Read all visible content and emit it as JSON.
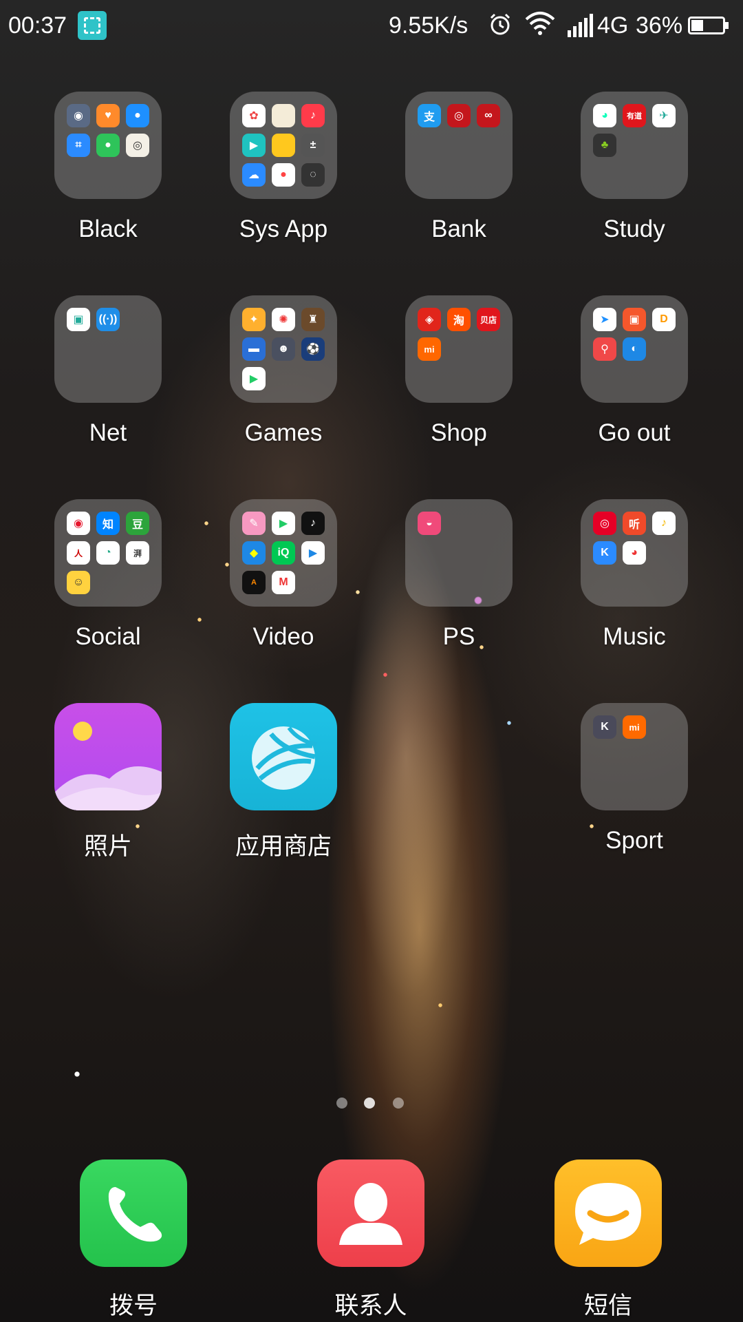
{
  "status_bar": {
    "time": "00:37",
    "net_speed": "9.55K/s",
    "network": "4G",
    "battery": "36%",
    "icons": [
      "screenshot-icon",
      "alarm-icon",
      "wifi-icon",
      "signal-icon",
      "battery-icon"
    ]
  },
  "folders": [
    {
      "name": "Black",
      "apps": [
        "settings",
        "health",
        "maps",
        "scan",
        "recorder",
        "camera"
      ]
    },
    {
      "name": "Sys App",
      "apps": [
        "gallery",
        "notes",
        "music",
        "video",
        "files",
        "calculator",
        "cloud",
        "recorder",
        "compass"
      ]
    },
    {
      "name": "Bank",
      "apps": [
        "alipay",
        "bank-1",
        "bank-2"
      ]
    },
    {
      "name": "Study",
      "apps": [
        "dictionary",
        "youdao",
        "study-app",
        "study-app-2"
      ]
    },
    {
      "name": "Net",
      "apps": [
        "net-app",
        "hotspot-app"
      ]
    },
    {
      "name": "Games",
      "apps": [
        "game-1",
        "game-2",
        "game-3",
        "game-4",
        "game-5",
        "game-6",
        "play-store"
      ]
    },
    {
      "name": "Shop",
      "apps": [
        "jd",
        "taobao",
        "weidian",
        "mi-shop"
      ]
    },
    {
      "name": "Go out",
      "apps": [
        "navigation",
        "bus",
        "didi",
        "bike",
        "ctrip"
      ]
    },
    {
      "name": "Social",
      "apps": [
        "weibo",
        "zhihu",
        "douban",
        "people-daily",
        "browser",
        "news",
        "qq-game"
      ]
    },
    {
      "name": "Video",
      "apps": [
        "video-1",
        "video-2",
        "tiktok",
        "video-4",
        "iqiyi",
        "tencent-video",
        "acfun",
        "video-8"
      ]
    },
    {
      "name": "PS",
      "apps": [
        "ps-app"
      ]
    },
    {
      "name": "Music",
      "apps": [
        "netease-music",
        "listen",
        "qq-music",
        "kugou",
        "music-5"
      ]
    },
    {
      "name": "Sport",
      "apps": [
        "keep",
        "mi-fit"
      ]
    }
  ],
  "apps": [
    {
      "name": "照片"
    },
    {
      "name": "应用商店"
    }
  ],
  "mini_texts": {
    "bank_alipay": "支",
    "study_youdao": "有道",
    "shop_taobao": "淘",
    "shop_weidian": "贝店",
    "shop_mi": "mi",
    "social_zhihu": "知",
    "social_douban": "豆",
    "sport_keep": "K",
    "sport_mi": "mi",
    "music_listen": "听"
  },
  "pager": {
    "pages": 3,
    "active": 2
  },
  "dock": [
    {
      "name": "拨号",
      "color": "#2ecc4a"
    },
    {
      "name": "联系人",
      "color": "#f2454f"
    },
    {
      "name": "短信",
      "color": "#fcae18"
    }
  ]
}
